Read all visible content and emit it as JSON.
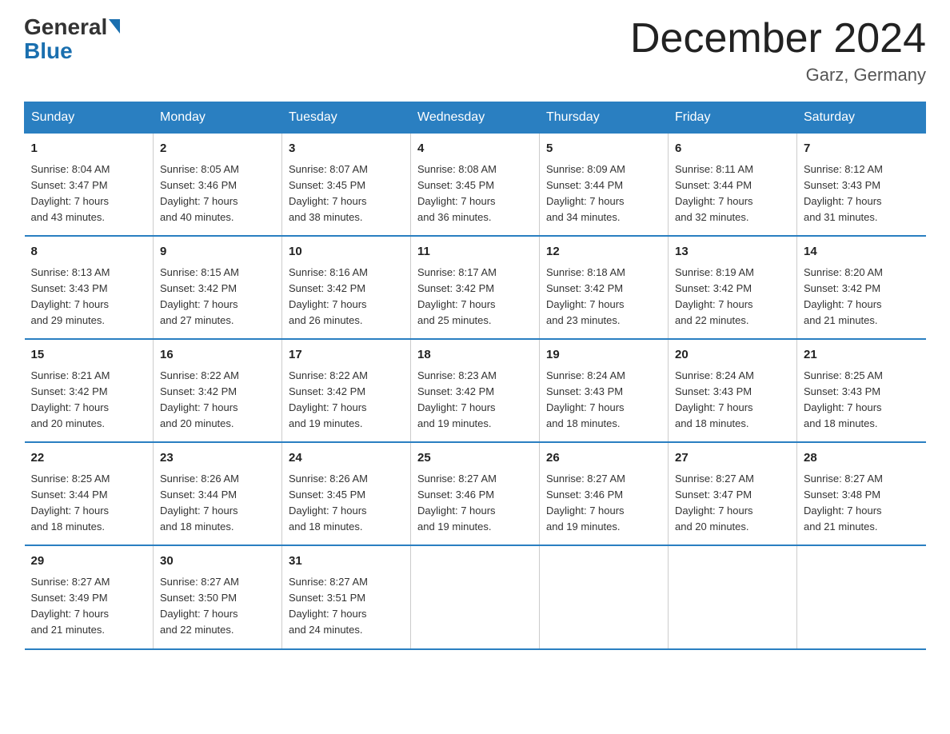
{
  "header": {
    "logo": {
      "general": "General",
      "blue": "Blue"
    },
    "title": "December 2024",
    "location": "Garz, Germany"
  },
  "days_of_week": [
    "Sunday",
    "Monday",
    "Tuesday",
    "Wednesday",
    "Thursday",
    "Friday",
    "Saturday"
  ],
  "weeks": [
    [
      {
        "day": "1",
        "info": "Sunrise: 8:04 AM\nSunset: 3:47 PM\nDaylight: 7 hours\nand 43 minutes."
      },
      {
        "day": "2",
        "info": "Sunrise: 8:05 AM\nSunset: 3:46 PM\nDaylight: 7 hours\nand 40 minutes."
      },
      {
        "day": "3",
        "info": "Sunrise: 8:07 AM\nSunset: 3:45 PM\nDaylight: 7 hours\nand 38 minutes."
      },
      {
        "day": "4",
        "info": "Sunrise: 8:08 AM\nSunset: 3:45 PM\nDaylight: 7 hours\nand 36 minutes."
      },
      {
        "day": "5",
        "info": "Sunrise: 8:09 AM\nSunset: 3:44 PM\nDaylight: 7 hours\nand 34 minutes."
      },
      {
        "day": "6",
        "info": "Sunrise: 8:11 AM\nSunset: 3:44 PM\nDaylight: 7 hours\nand 32 minutes."
      },
      {
        "day": "7",
        "info": "Sunrise: 8:12 AM\nSunset: 3:43 PM\nDaylight: 7 hours\nand 31 minutes."
      }
    ],
    [
      {
        "day": "8",
        "info": "Sunrise: 8:13 AM\nSunset: 3:43 PM\nDaylight: 7 hours\nand 29 minutes."
      },
      {
        "day": "9",
        "info": "Sunrise: 8:15 AM\nSunset: 3:42 PM\nDaylight: 7 hours\nand 27 minutes."
      },
      {
        "day": "10",
        "info": "Sunrise: 8:16 AM\nSunset: 3:42 PM\nDaylight: 7 hours\nand 26 minutes."
      },
      {
        "day": "11",
        "info": "Sunrise: 8:17 AM\nSunset: 3:42 PM\nDaylight: 7 hours\nand 25 minutes."
      },
      {
        "day": "12",
        "info": "Sunrise: 8:18 AM\nSunset: 3:42 PM\nDaylight: 7 hours\nand 23 minutes."
      },
      {
        "day": "13",
        "info": "Sunrise: 8:19 AM\nSunset: 3:42 PM\nDaylight: 7 hours\nand 22 minutes."
      },
      {
        "day": "14",
        "info": "Sunrise: 8:20 AM\nSunset: 3:42 PM\nDaylight: 7 hours\nand 21 minutes."
      }
    ],
    [
      {
        "day": "15",
        "info": "Sunrise: 8:21 AM\nSunset: 3:42 PM\nDaylight: 7 hours\nand 20 minutes."
      },
      {
        "day": "16",
        "info": "Sunrise: 8:22 AM\nSunset: 3:42 PM\nDaylight: 7 hours\nand 20 minutes."
      },
      {
        "day": "17",
        "info": "Sunrise: 8:22 AM\nSunset: 3:42 PM\nDaylight: 7 hours\nand 19 minutes."
      },
      {
        "day": "18",
        "info": "Sunrise: 8:23 AM\nSunset: 3:42 PM\nDaylight: 7 hours\nand 19 minutes."
      },
      {
        "day": "19",
        "info": "Sunrise: 8:24 AM\nSunset: 3:43 PM\nDaylight: 7 hours\nand 18 minutes."
      },
      {
        "day": "20",
        "info": "Sunrise: 8:24 AM\nSunset: 3:43 PM\nDaylight: 7 hours\nand 18 minutes."
      },
      {
        "day": "21",
        "info": "Sunrise: 8:25 AM\nSunset: 3:43 PM\nDaylight: 7 hours\nand 18 minutes."
      }
    ],
    [
      {
        "day": "22",
        "info": "Sunrise: 8:25 AM\nSunset: 3:44 PM\nDaylight: 7 hours\nand 18 minutes."
      },
      {
        "day": "23",
        "info": "Sunrise: 8:26 AM\nSunset: 3:44 PM\nDaylight: 7 hours\nand 18 minutes."
      },
      {
        "day": "24",
        "info": "Sunrise: 8:26 AM\nSunset: 3:45 PM\nDaylight: 7 hours\nand 18 minutes."
      },
      {
        "day": "25",
        "info": "Sunrise: 8:27 AM\nSunset: 3:46 PM\nDaylight: 7 hours\nand 19 minutes."
      },
      {
        "day": "26",
        "info": "Sunrise: 8:27 AM\nSunset: 3:46 PM\nDaylight: 7 hours\nand 19 minutes."
      },
      {
        "day": "27",
        "info": "Sunrise: 8:27 AM\nSunset: 3:47 PM\nDaylight: 7 hours\nand 20 minutes."
      },
      {
        "day": "28",
        "info": "Sunrise: 8:27 AM\nSunset: 3:48 PM\nDaylight: 7 hours\nand 21 minutes."
      }
    ],
    [
      {
        "day": "29",
        "info": "Sunrise: 8:27 AM\nSunset: 3:49 PM\nDaylight: 7 hours\nand 21 minutes."
      },
      {
        "day": "30",
        "info": "Sunrise: 8:27 AM\nSunset: 3:50 PM\nDaylight: 7 hours\nand 22 minutes."
      },
      {
        "day": "31",
        "info": "Sunrise: 8:27 AM\nSunset: 3:51 PM\nDaylight: 7 hours\nand 24 minutes."
      },
      {
        "day": "",
        "info": ""
      },
      {
        "day": "",
        "info": ""
      },
      {
        "day": "",
        "info": ""
      },
      {
        "day": "",
        "info": ""
      }
    ]
  ]
}
